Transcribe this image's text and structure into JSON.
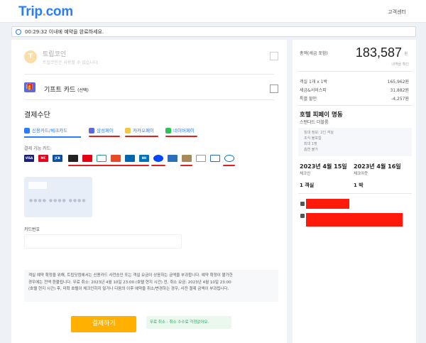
{
  "header": {
    "logo_prefix": "Trip",
    "logo_dot": ".",
    "logo_suffix": "com",
    "right_link": "고객센터"
  },
  "timer": {
    "text": "00:29:32 이내에 예약을 완료하세요."
  },
  "left": {
    "coin": {
      "title": "트립코인",
      "subtitle": "트립코인은 사용할 수 없습니다."
    },
    "gift": {
      "title": "기프트 카드",
      "suffix": "(선택)"
    },
    "payment_title": "결제수단",
    "tabs": [
      {
        "label": "신용카드/체크카드",
        "color": "#287dfa",
        "active": true
      },
      {
        "label": "삼성페이",
        "color": "#5b6ad9"
      },
      {
        "label": "카카오페이",
        "color": "#f5c842"
      },
      {
        "label": "네이버페이",
        "color": "#2fc15a"
      }
    ],
    "cards_label": "결제 가능 카드:",
    "cards": [
      {
        "name": "VISA",
        "color": "#1a1f71",
        "text": "VISA"
      },
      {
        "name": "mastercard",
        "color": "#eb001b",
        "text": "MC"
      },
      {
        "name": "JCB",
        "color": "#0b4ea2",
        "text": "JCB"
      },
      {
        "name": "hyundai",
        "color": "#222222",
        "text": ""
      },
      {
        "name": "lotte",
        "color": "#e60012",
        "text": ""
      },
      {
        "name": "hana",
        "color": "#ffffff",
        "text": ""
      },
      {
        "name": "samsung",
        "color": "#e84a27",
        "text": ""
      },
      {
        "name": "woori",
        "color": "#0067ac",
        "text": ""
      },
      {
        "name": "NH",
        "color": "#0072bc",
        "text": "NH"
      },
      {
        "name": "shinhan",
        "color": "#0046ff",
        "text": ""
      },
      {
        "name": "citi",
        "color": "#2a6fb8",
        "text": ""
      },
      {
        "name": "bc",
        "color": "#d6d6d6",
        "text": ""
      },
      {
        "name": "kb",
        "color": "#a68a5a",
        "text": ""
      },
      {
        "name": "kakaobank",
        "color": "#ffffff",
        "text": ""
      },
      {
        "name": "diners",
        "color": "#ffffff",
        "text": ""
      },
      {
        "name": "amex",
        "color": "#ffffff",
        "text": ""
      }
    ],
    "card_dots": "●●●●  ●●●●  ●●●●",
    "password_label": "카드번호",
    "notice_lines": [
      "객실 예약 확정을 위해, 트립닷컴에서는 신용카드 사전승인 또는 객실 요금이 상응하는 금액을 부과합니다. 예약 확정이 불가한",
      "경우에는 전액 환불됩니다. 무료 취소: 2023년 4월 10일 23:00 (호텔 현지 시간) 전, 취소 요금: 2023년 4월 10일 23:00",
      "(호텔 현지 시간) 후, 미확 호텔이 체크인하지 않거나 다음의 이후 예약을 취소/변경하는 경우, 사전 결제 금액이 부과됩니다."
    ],
    "pay_button": "결제하기",
    "free_cancel": "무료 취소 - 취소 수수료 걱정없어요."
  },
  "right": {
    "total_label": "총액(세금 포함)",
    "total_amount": "183,587",
    "total_unit": "원",
    "after_note": "내역을 확인",
    "lines": [
      {
        "label": "객실 1개 x 1박",
        "value": "165,962원"
      },
      {
        "label": "세금&서비스피",
        "value": "31,882원"
      },
      {
        "label": "특별 할인",
        "value": "-4,257원"
      }
    ],
    "hotel_title": "호텔 피페이 명동",
    "hotel_sub": "스탠다드 더블룸",
    "policy_lines": [
      "침대 정보: 2인 객실",
      "조식 불포함",
      "최대 1명",
      "흡연 불가"
    ],
    "checkin_date": "2023년 4월 15일",
    "checkin_label": "체크인",
    "checkout_date": "2023년 4월 16일",
    "checkout_label": "체크아웃",
    "rooms": "1 객실",
    "nights": "1 박"
  }
}
